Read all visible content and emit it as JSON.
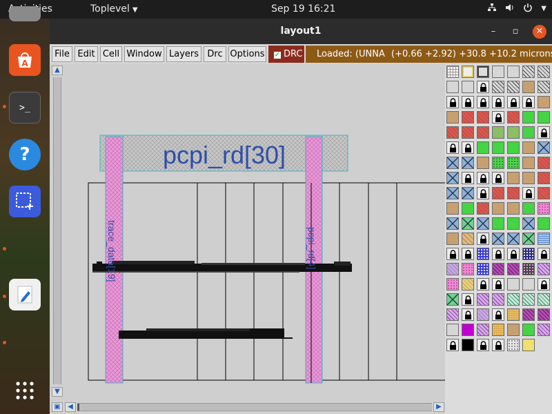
{
  "topbar": {
    "activities": "Activities",
    "app_menu": "Toplevel",
    "clock": "Sep 19  16:21"
  },
  "window": {
    "title": "layout1",
    "controls": {
      "minimize": "–",
      "maximize": "▫",
      "close": "✕"
    }
  },
  "menubar": {
    "items": [
      "File",
      "Edit",
      "Cell",
      "Window",
      "Layers",
      "Drc",
      "Options"
    ],
    "drc_toggle": {
      "label": "DRC",
      "checked": true
    },
    "status_loaded": "Loaded: (UNNA",
    "status_coords": "(+0.66 +2.92) +30.8 +10.2 microns"
  },
  "layout": {
    "labels": {
      "top_label": "pcpi_rd[30]",
      "left_label": "trace_data[19]",
      "right_label": "pcpi_rd[4]"
    }
  },
  "colors": {
    "label_blue": "#2e4fa8",
    "pink_fill": "#e99ad6",
    "cyan_outline": "#3fb4c8",
    "drc_red": "#8b2b1e",
    "status_brown": "#8d5a16",
    "accent_orange": "#e95420"
  },
  "palette": {
    "tiles": [
      [
        "grid",
        "yellowbox",
        "graybox",
        "ltgray",
        "ltgray",
        "hatch",
        "hatch"
      ],
      [
        "ltgray",
        "ltgray",
        "lock",
        "hatch",
        "hatch",
        "tan",
        "hatch"
      ],
      [
        "lock",
        "lock",
        "lock",
        "lock",
        "lock",
        "lock",
        "tan"
      ],
      [
        "tan",
        "red",
        "red",
        "lock",
        "red",
        "green",
        "green"
      ],
      [
        "red",
        "red",
        "red",
        "greenhatch",
        "greenhatch",
        "green",
        "lock"
      ],
      [
        "lock",
        "lock",
        "green",
        "green",
        "green",
        "tan",
        "bluex"
      ],
      [
        "bluex",
        "bluex",
        "tan",
        "greendot",
        "greendot",
        "tan",
        "red"
      ],
      [
        "bluex",
        "lock",
        "lock",
        "lock",
        "tan",
        "tan",
        "red"
      ],
      [
        "bluex",
        "bluex",
        "lock",
        "red",
        "red",
        "lock",
        "red"
      ],
      [
        "tan",
        "green",
        "red",
        "tan",
        "tan",
        "green",
        "pink"
      ],
      [
        "bluex",
        "greenx",
        "bluex",
        "green",
        "green",
        "bluex",
        "green"
      ],
      [
        "tan",
        "tanhatch",
        "lock",
        "bluex",
        "bluex",
        "greenx",
        "bluewave"
      ],
      [
        "lock",
        "lock",
        "blue",
        "lock",
        "lock",
        "bluedot",
        "lock"
      ],
      [
        "lilac",
        "pink",
        "blue",
        "purple",
        "purple",
        "dark",
        "violet"
      ],
      [
        "pink",
        "yellowhatch",
        "lock",
        "lock",
        "ltgray",
        "ltgray",
        "lock"
      ],
      [
        "greenx",
        "lock",
        "violet",
        "violet",
        "teal",
        "teal",
        "teal"
      ],
      [
        "violet",
        "lock",
        "lilac",
        "lock",
        "gold",
        "purple",
        "purple"
      ],
      [
        "ltgray",
        "magenta",
        "violet",
        "gold",
        "tan",
        "green",
        "violet"
      ],
      [
        "lock",
        "black",
        "lock",
        "lock",
        "dots",
        "yellow",
        ""
      ]
    ]
  },
  "dock": {
    "items": [
      {
        "name": "ubuntu-software-icon",
        "running": false
      },
      {
        "name": "terminal-icon",
        "running": true
      },
      {
        "name": "help-icon",
        "running": false
      },
      {
        "name": "screenshot-icon",
        "running": true
      },
      {
        "name": "text-editor-icon",
        "running": true
      }
    ]
  }
}
